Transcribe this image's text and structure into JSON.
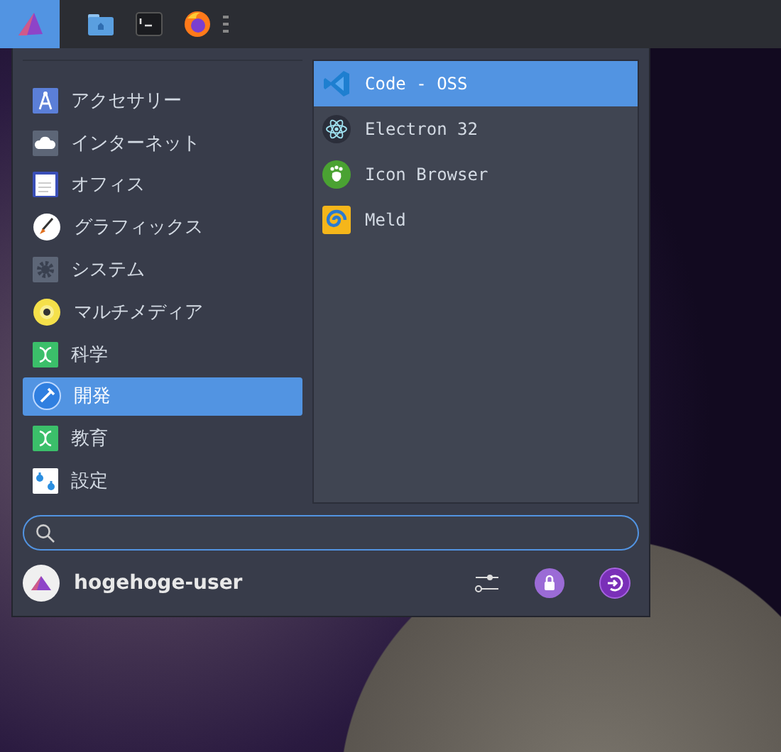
{
  "taskbar": {
    "items": [
      {
        "kind": "launcher",
        "selected": true
      },
      {
        "kind": "folder",
        "selected": false
      },
      {
        "kind": "terminal",
        "selected": false
      },
      {
        "kind": "browser",
        "selected": false
      },
      {
        "kind": "more",
        "selected": false
      }
    ]
  },
  "categories": [
    {
      "kind": "accessories",
      "label": "アクセサリー",
      "selected": false
    },
    {
      "kind": "internet",
      "label": "インターネット",
      "selected": false
    },
    {
      "kind": "office",
      "label": "オフィス",
      "selected": false
    },
    {
      "kind": "graphics",
      "label": "グラフィックス",
      "selected": false
    },
    {
      "kind": "system",
      "label": "システム",
      "selected": false
    },
    {
      "kind": "multimedia",
      "label": "マルチメディア",
      "selected": false
    },
    {
      "kind": "science",
      "label": "科学",
      "selected": false
    },
    {
      "kind": "development",
      "label": "開発",
      "selected": true
    },
    {
      "kind": "education",
      "label": "教育",
      "selected": false
    },
    {
      "kind": "settings",
      "label": "設定",
      "selected": false
    }
  ],
  "apps": [
    {
      "kind": "code",
      "label": "Code - OSS",
      "selected": true
    },
    {
      "kind": "electron",
      "label": "Electron 32",
      "selected": false
    },
    {
      "kind": "icons",
      "label": "Icon Browser",
      "selected": false
    },
    {
      "kind": "meld",
      "label": "Meld",
      "selected": false
    }
  ],
  "user": {
    "name": "hogehoge-user"
  }
}
